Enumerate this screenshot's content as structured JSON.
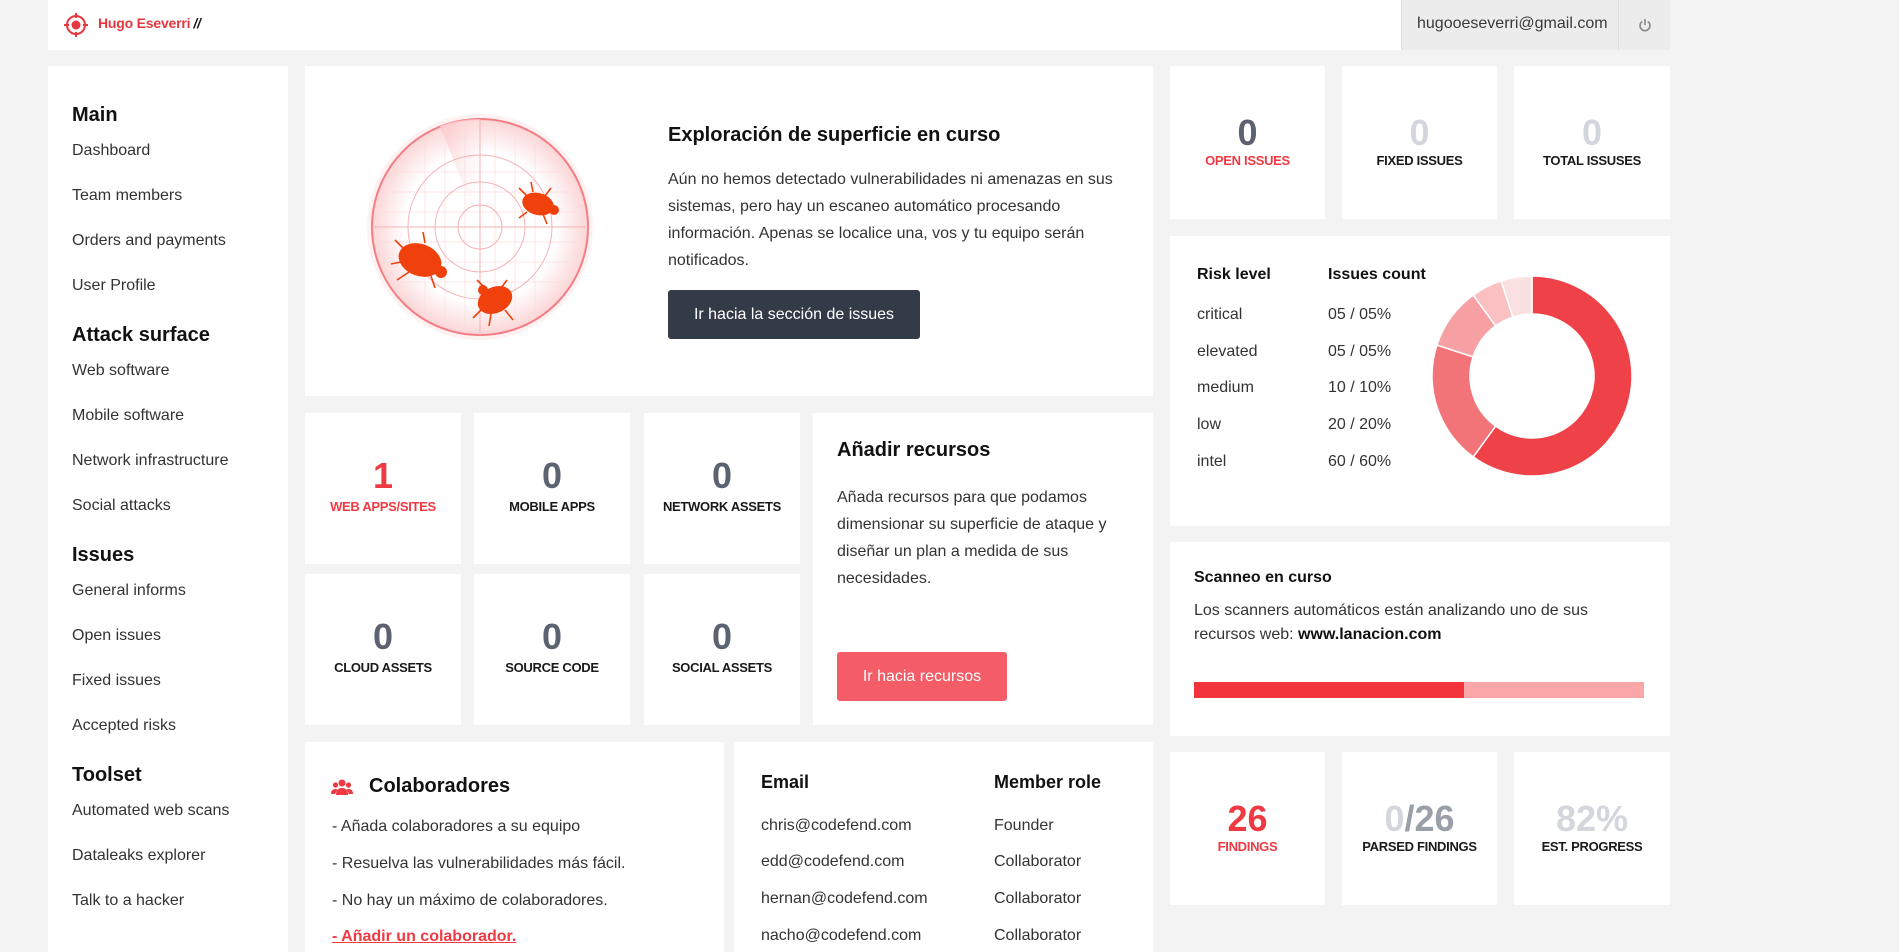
{
  "topbar": {
    "brand": "Hugo Eseverri",
    "brand_suffix": "//",
    "email": "hugooeseverri@gmail.com"
  },
  "sidebar": {
    "sections": [
      {
        "title": "Main",
        "items": [
          "Dashboard",
          "Team members",
          "Orders and payments",
          "User Profile"
        ]
      },
      {
        "title": "Attack surface",
        "items": [
          "Web software",
          "Mobile software",
          "Network infrastructure",
          "Social attacks"
        ]
      },
      {
        "title": "Issues",
        "items": [
          "General informs",
          "Open issues",
          "Fixed issues",
          "Accepted risks"
        ]
      },
      {
        "title": "Toolset",
        "items": [
          "Automated web scans",
          "Dataleaks explorer",
          "Talk to a hacker"
        ]
      }
    ]
  },
  "scan_hero": {
    "title": "Exploración de superficie en curso",
    "text": "Aún no hemos detectado vulnerabilidades ni amenazas en sus sistemas, pero hay un escaneo automático procesando información. Apenas se localice una, vos y tu equipo serán notificados.",
    "button": "Ir hacia la sección de issues"
  },
  "issue_stats": [
    {
      "value": "0",
      "label": "OPEN ISSUES"
    },
    {
      "value": "0",
      "label": "FIXED ISSUES"
    },
    {
      "value": "0",
      "label": "TOTAL ISSUSES"
    }
  ],
  "asset_stats": [
    {
      "value": "1",
      "label": "WEB APPS/SITES"
    },
    {
      "value": "0",
      "label": "MOBILE APPS"
    },
    {
      "value": "0",
      "label": "NETWORK ASSETS"
    },
    {
      "value": "0",
      "label": "CLOUD ASSETS"
    },
    {
      "value": "0",
      "label": "SOURCE CODE"
    },
    {
      "value": "0",
      "label": "SOCIAL ASSETS"
    }
  ],
  "add_resources": {
    "title": "Añadir recursos",
    "text": "Añada recursos para que podamos dimensionar su superficie de ataque y diseñar un plan a medida de sus necesidades.",
    "button": "Ir hacia recursos"
  },
  "risk": {
    "header_level": "Risk level",
    "header_count": "Issues count",
    "rows": [
      {
        "level": "critical",
        "count": "05 / 05%",
        "pct": 5,
        "color": "#fbe0e1"
      },
      {
        "level": "elevated",
        "count": "05 / 05%",
        "pct": 5,
        "color": "#fac0c2"
      },
      {
        "level": "medium",
        "count": "10 / 10%",
        "pct": 10,
        "color": "#f7a0a4"
      },
      {
        "level": "low",
        "count": "20 / 20%",
        "pct": 20,
        "color": "#f27378"
      },
      {
        "level": "intel",
        "count": "60 / 60%",
        "pct": 60,
        "color": "#ef4148"
      }
    ]
  },
  "scanning": {
    "title": "Scanneo en curso",
    "text": "Los scanners automáticos están analizando uno de sus recursos web:",
    "domain": "www.lanacion.com",
    "progress": 0.6
  },
  "collaborators": {
    "title": "Colaboradores",
    "lines": [
      "- Añada colaboradores a su equipo",
      "- Resuelva las vulnerabilidades más fácil.",
      "- No hay un máximo de colaboradores."
    ],
    "link": "- Añadir un colaborador."
  },
  "members": {
    "header_email": "Email",
    "header_role": "Member role",
    "rows": [
      {
        "email": "chris@codefend.com",
        "role": "Founder"
      },
      {
        "email": "edd@codefend.com",
        "role": "Collaborator"
      },
      {
        "email": "hernan@codefend.com",
        "role": "Collaborator"
      },
      {
        "email": "nacho@codefend.com",
        "role": "Collaborator"
      }
    ]
  },
  "findings_stats": [
    {
      "value": "26",
      "label": "FINDINGS"
    },
    {
      "value": "0/26",
      "value_a": "0",
      "value_b": "/26",
      "label": "PARSED FINDINGS"
    },
    {
      "value": "82%",
      "label": "EST. PROGRESS"
    }
  ],
  "colors": {
    "accent": "#f03a43",
    "button_dark": "#343b48",
    "button_red": "#f45d67",
    "muted": "#d3d6dc"
  }
}
